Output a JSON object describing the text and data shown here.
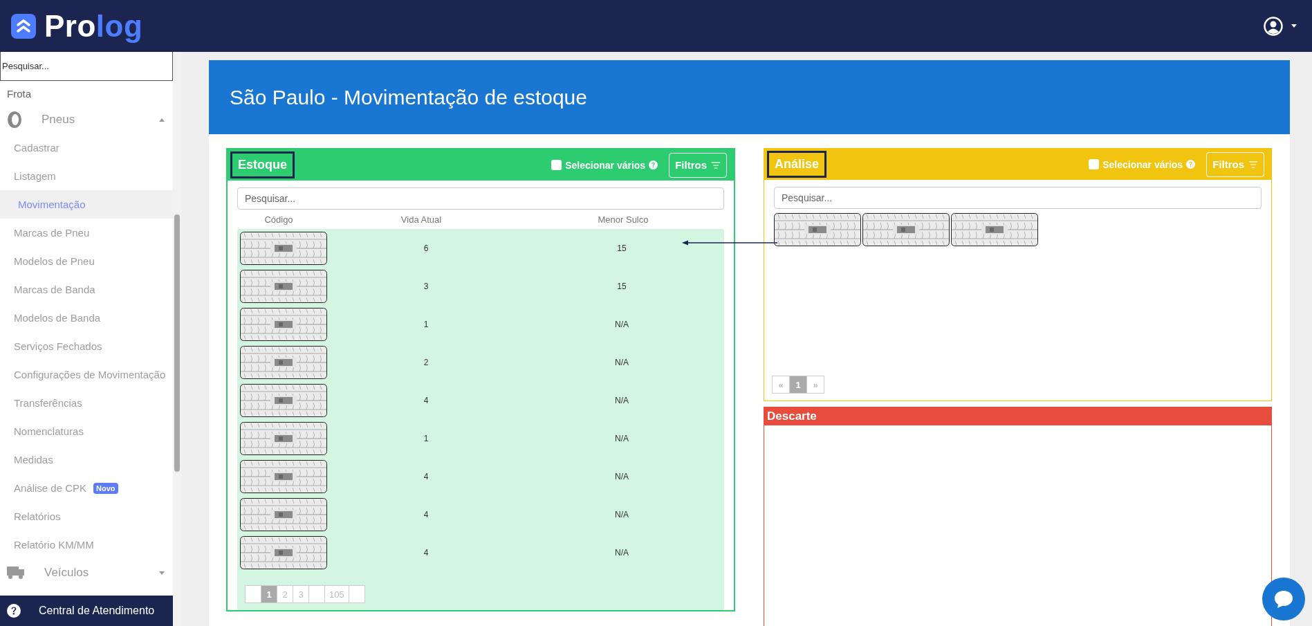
{
  "header": {
    "logo": {
      "parts": [
        "Pro",
        "log"
      ]
    }
  },
  "sidebar": {
    "search": {
      "placeholder": "Pesquisar..."
    },
    "section": "Frota",
    "groups": [
      {
        "label": "Pneus",
        "kind": "tire",
        "expanded": true,
        "children": [
          {
            "label": "Cadastrar",
            "selected": false
          },
          {
            "label": "Listagem",
            "selected": false
          },
          {
            "label": "Movimentação",
            "selected": true
          },
          {
            "label": "Marcas de Pneu",
            "selected": false
          },
          {
            "label": "Modelos de Pneu",
            "selected": false
          },
          {
            "label": "Marcas de Banda",
            "selected": false
          },
          {
            "label": "Modelos de Banda",
            "selected": false
          },
          {
            "label": "Serviços Fechados",
            "selected": false
          },
          {
            "label": "Configurações de Movimentação",
            "selected": false
          },
          {
            "label": "Transferências",
            "selected": false
          },
          {
            "label": "Nomenclaturas",
            "selected": false
          },
          {
            "label": "Medidas",
            "selected": false
          },
          {
            "label": "Análise de CPK",
            "selected": false,
            "badge": "Novo"
          },
          {
            "label": "Relatórios",
            "selected": false
          },
          {
            "label": "Relatório KM/MM",
            "selected": false
          }
        ]
      },
      {
        "label": "Veículos",
        "kind": "truck",
        "expanded": false
      }
    ]
  },
  "help_bar": {
    "label": "Central de Atendimento"
  },
  "page": {
    "title": "São Paulo - Movimentação de estoque"
  },
  "stock_panel": {
    "title": "Estoque",
    "select_multiple": {
      "label": "Selecionar vários",
      "checked": false
    },
    "filter_button": "Filtros",
    "search": {
      "placeholder": "Pesquisar..."
    },
    "columns": [
      "Código",
      "Vida Atual",
      "Menor Sulco"
    ],
    "rows": [
      {
        "vida_atual": "6",
        "menor_sulco": "15"
      },
      {
        "vida_atual": "3",
        "menor_sulco": "15"
      },
      {
        "vida_atual": "1",
        "menor_sulco": "N/A"
      },
      {
        "vida_atual": "2",
        "menor_sulco": "N/A"
      },
      {
        "vida_atual": "4",
        "menor_sulco": "N/A"
      },
      {
        "vida_atual": "1",
        "menor_sulco": "N/A"
      },
      {
        "vida_atual": "4",
        "menor_sulco": "N/A"
      },
      {
        "vida_atual": "4",
        "menor_sulco": "N/A"
      },
      {
        "vida_atual": "4",
        "menor_sulco": "N/A"
      }
    ],
    "pages": [
      {
        "label": "1",
        "selected": true
      },
      {
        "label": "2",
        "selected": false
      },
      {
        "label": "3",
        "selected": false
      },
      {
        "label": "105",
        "selected": false
      }
    ]
  },
  "analysis_panel": {
    "title": "Análise",
    "select_multiple": {
      "label": "Selecionar vários",
      "checked": false
    },
    "filter_button": "Filtros",
    "search": {
      "placeholder": "Pesquisar..."
    },
    "pagination": {
      "prev": "«",
      "next": "»",
      "pages": [
        {
          "label": "1",
          "selected": true
        }
      ]
    }
  },
  "discard_panel": {
    "title": "Descarte"
  }
}
